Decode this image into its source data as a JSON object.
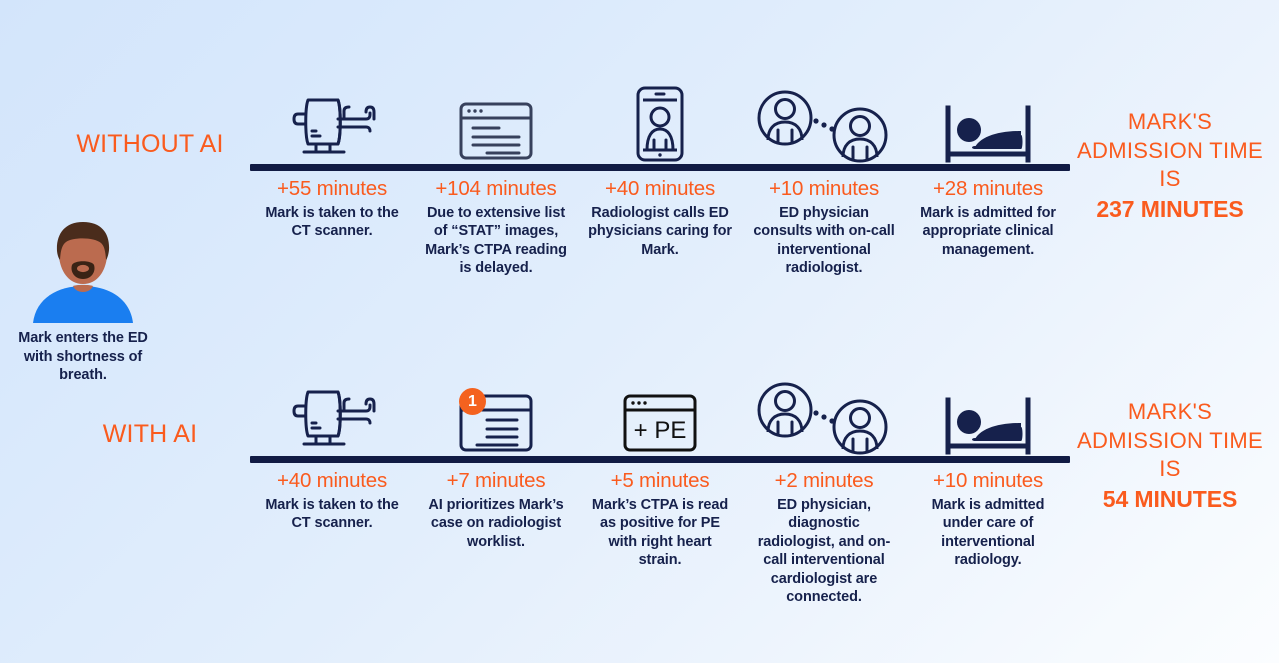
{
  "colors": {
    "accent_orange": "#fa5b1e",
    "navy": "#16214c",
    "bar_navy": "#111b44",
    "badge_orange": "#f4621f",
    "shirt_blue": "#1a7ef0",
    "skin": "#bb6b4f",
    "hair": "#4a2c1c",
    "background_top_left": "#d3e5fb",
    "background_bottom_right": "#fbfdff"
  },
  "patient": {
    "avatar_name": "mark-avatar",
    "caption": "Mark enters the ED with shortness of breath."
  },
  "rows": [
    {
      "id": "without-ai",
      "label": "WITHOUT AI",
      "total_lead": "MARK'S ADMISSION TIME IS",
      "total_value": "237 MINUTES",
      "steps": [
        {
          "icon": "ct-scanner-icon",
          "time": "+55 minutes",
          "desc": "Mark is taken to the CT scanner."
        },
        {
          "icon": "worklist-window-icon",
          "time": "+104 minutes",
          "desc": "Due to extensive list of “STAT” images, Mark’s CTPA reading is delayed."
        },
        {
          "icon": "phone-call-icon",
          "time": "+40 minutes",
          "desc": "Radiologist calls ED physicians caring for Mark."
        },
        {
          "icon": "two-people-consult-icon",
          "time": "+10 minutes",
          "desc": "ED physician consults with on-call interventional radiologist."
        },
        {
          "icon": "hospital-bed-icon",
          "time": "+28 minutes",
          "desc": "Mark is admitted for appropriate clinical management."
        }
      ]
    },
    {
      "id": "with-ai",
      "label": "WITH AI",
      "total_lead": "MARK'S ADMISSION TIME IS",
      "total_value": "54 MINUTES",
      "steps": [
        {
          "icon": "ct-scanner-icon",
          "time": "+40 minutes",
          "desc": "Mark is taken to the CT scanner."
        },
        {
          "icon": "worklist-window-priority-icon",
          "badge": "1",
          "time": "+7 minutes",
          "desc": "AI prioritizes Mark’s case on radiologist worklist."
        },
        {
          "icon": "pe-result-window-icon",
          "icon_text": "+ PE",
          "time": "+5 minutes",
          "desc": "Mark’s CTPA is read as positive for PE with right heart strain."
        },
        {
          "icon": "two-people-consult-icon",
          "time": "+2 minutes",
          "desc": "ED physician, diagnostic radiologist, and on-call interventional cardiologist are connected."
        },
        {
          "icon": "hospital-bed-icon",
          "time": "+10 minutes",
          "desc": "Mark is admitted under care of interventional radiology."
        }
      ]
    }
  ]
}
